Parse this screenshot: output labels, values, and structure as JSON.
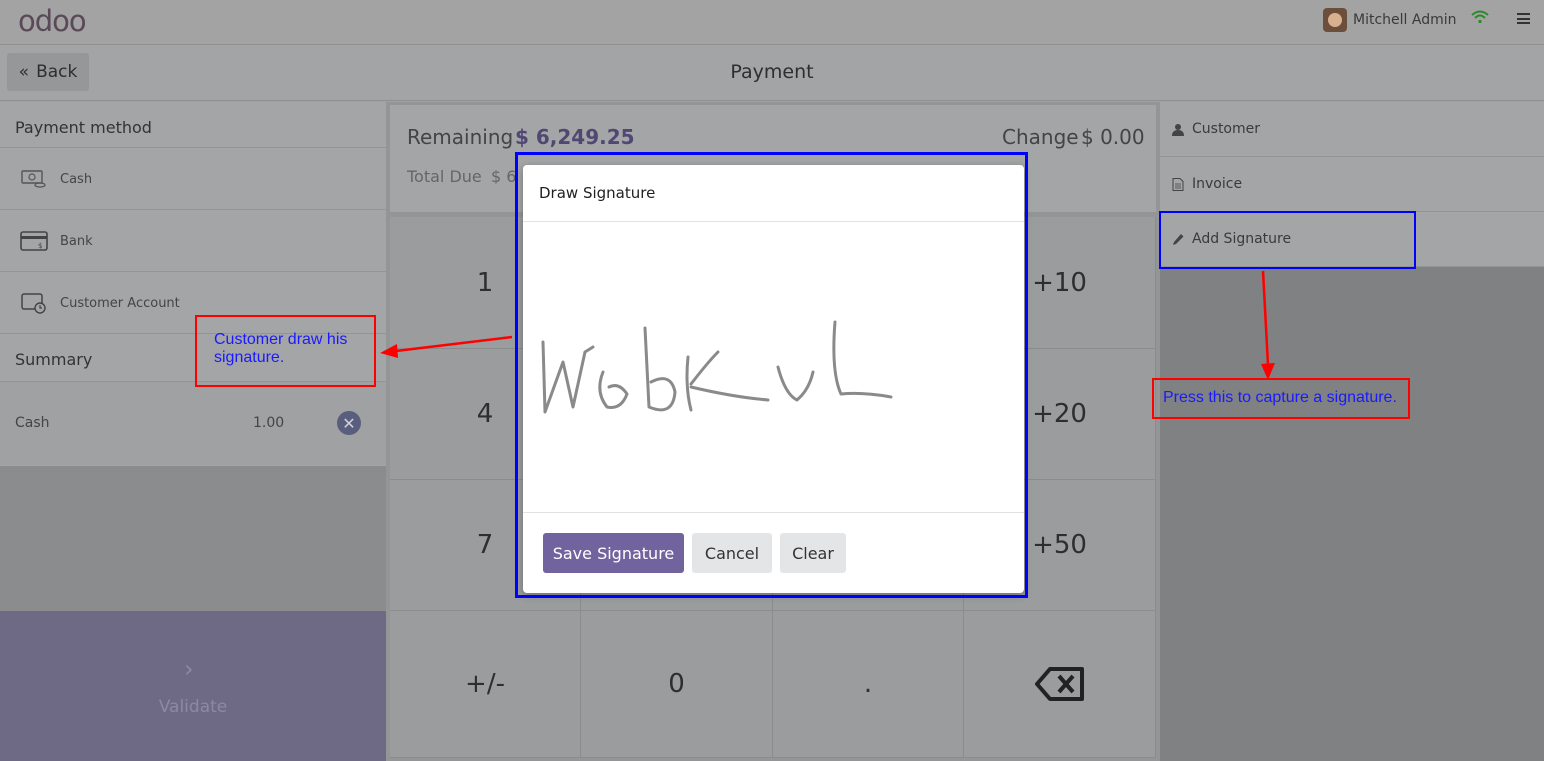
{
  "header": {
    "logo": "odoo",
    "user_name": "Mitchell Admin",
    "icons": [
      "avatar",
      "wifi-icon",
      "hamburger-menu-icon"
    ]
  },
  "subheader": {
    "back_label": "Back",
    "title": "Payment"
  },
  "payment_methods": {
    "title": "Payment method",
    "items": [
      {
        "label": "Cash",
        "icon": "cash-icon"
      },
      {
        "label": "Bank",
        "icon": "bank-card-icon"
      },
      {
        "label": "Customer Account",
        "icon": "customer-account-icon"
      }
    ]
  },
  "summary": {
    "title": "Summary",
    "lines": [
      {
        "method": "Cash",
        "amount": "1.00"
      }
    ]
  },
  "validate": {
    "label": "Validate"
  },
  "status": {
    "remaining_label": "Remaining",
    "remaining_value": "$ 6,249.25",
    "change_label": "Change",
    "change_value": "$ 0.00",
    "total_due_label": "Total Due",
    "total_due_value": "$ 6"
  },
  "numpad": {
    "keys": [
      "1",
      "4",
      "7",
      "+/-",
      "0",
      ".",
      "+10",
      "+20",
      "+50"
    ],
    "backspace_icon": "backspace-icon"
  },
  "right_panel": {
    "customer": "Customer",
    "invoice": "Invoice",
    "add_signature": "Add Signature"
  },
  "modal": {
    "title": "Draw Signature",
    "save_label": "Save Signature",
    "cancel_label": "Cancel",
    "clear_label": "Clear",
    "signature_text": "WebKuL"
  },
  "annotations": {
    "draw_note": "Customer draw his signature.",
    "press_note": "Press this to capture a signature.",
    "colors": {
      "highlight": "#0000ff",
      "callout": "#ff0000",
      "note_text": "#1a1aff"
    }
  },
  "colors": {
    "accent": "#71639e",
    "amount": "#504872"
  }
}
